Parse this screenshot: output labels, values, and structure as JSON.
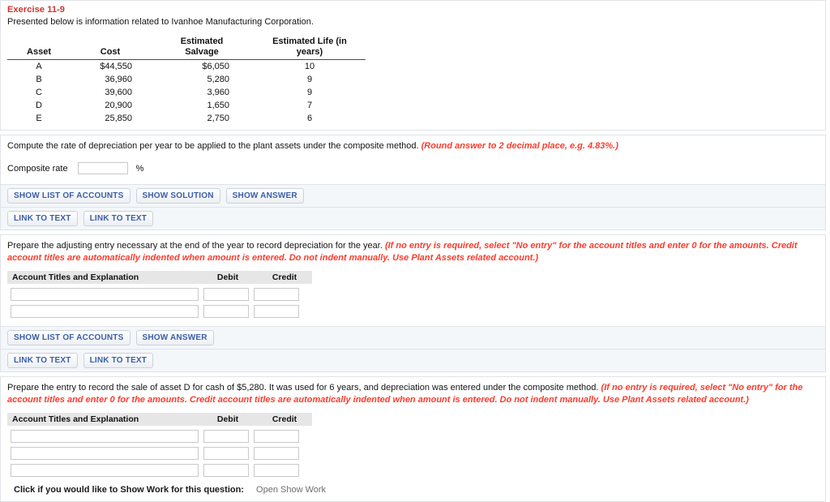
{
  "exercise": {
    "title": "Exercise 11-9",
    "intro": "Presented below is information related to Ivanhoe Manufacturing Corporation."
  },
  "asset_table": {
    "headers": {
      "asset": "Asset",
      "cost": "Cost",
      "salvage_line1": "Estimated",
      "salvage_line2": "Salvage",
      "life_line1": "Estimated Life (in",
      "life_line2": "years)"
    },
    "rows": [
      {
        "asset": "A",
        "cost": "$44,550",
        "salvage": "$6,050",
        "life": "10"
      },
      {
        "asset": "B",
        "cost": "36,960",
        "salvage": "5,280",
        "life": "9"
      },
      {
        "asset": "C",
        "cost": "39,600",
        "salvage": "3,960",
        "life": "9"
      },
      {
        "asset": "D",
        "cost": "20,900",
        "salvage": "1,650",
        "life": "7"
      },
      {
        "asset": "E",
        "cost": "25,850",
        "salvage": "2,750",
        "life": "6"
      }
    ]
  },
  "part_a": {
    "prompt": "Compute the rate of depreciation per year to be applied to the plant assets under the composite method.",
    "prompt_red": "(Round answer to 2 decimal place, e.g. 4.83%.)",
    "rate_label": "Composite rate",
    "rate_value": "",
    "rate_placeholder": "",
    "percent_symbol": "%",
    "buttons_row1": [
      "SHOW LIST OF ACCOUNTS",
      "SHOW SOLUTION",
      "SHOW ANSWER"
    ],
    "buttons_row2": [
      "LINK TO TEXT",
      "LINK TO TEXT"
    ]
  },
  "part_b": {
    "prompt": "Prepare the adjusting entry necessary at the end of the year to record depreciation for the year.",
    "prompt_red": "(If no entry is required, select \"No entry\" for the account titles and enter 0 for the amounts. Credit account titles are automatically indented when amount is entered. Do not indent manually. Use Plant Assets related account.)",
    "table_headers": {
      "account": "Account Titles and Explanation",
      "debit": "Debit",
      "credit": "Credit"
    },
    "rows": [
      {
        "account": "",
        "debit": "",
        "credit": ""
      },
      {
        "account": "",
        "debit": "",
        "credit": ""
      }
    ],
    "buttons_row1": [
      "SHOW LIST OF ACCOUNTS",
      "SHOW ANSWER"
    ],
    "buttons_row2": [
      "LINK TO TEXT",
      "LINK TO TEXT"
    ]
  },
  "part_c": {
    "prompt": "Prepare the entry to record the sale of asset D for cash of $5,280. It was used for 6 years, and depreciation was entered under the composite method.",
    "prompt_red": "(If no entry is required, select \"No entry\" for the account titles and enter 0 for the amounts. Credit account titles are automatically indented when amount is entered. Do not indent manually. Use Plant Assets related account.)",
    "table_headers": {
      "account": "Account Titles and Explanation",
      "debit": "Debit",
      "credit": "Credit"
    },
    "rows": [
      {
        "account": "",
        "debit": "",
        "credit": ""
      },
      {
        "account": "",
        "debit": "",
        "credit": ""
      },
      {
        "account": "",
        "debit": "",
        "credit": ""
      }
    ]
  },
  "footer": {
    "show_work_label": "Click if you would like to Show Work for this question:",
    "show_work_link": "Open Show Work"
  },
  "colors": {
    "title_red": "#d0342c",
    "instruction_red": "#fb3c2d",
    "button_text_blue": "#3b5ea8",
    "panel_border": "#dfe3e8",
    "band_background": "#f4f7fa",
    "table_header_gray": "#e6e6e6"
  }
}
